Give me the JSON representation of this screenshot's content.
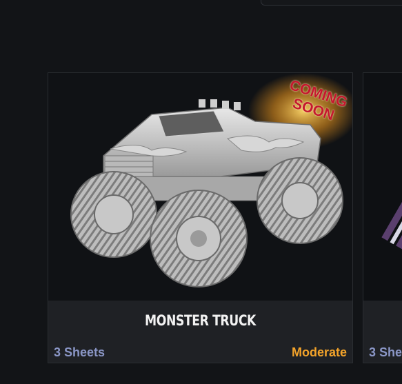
{
  "cards": [
    {
      "title": "MONSTER TRUCK",
      "sheets": "3 Sheets",
      "difficulty": "Moderate",
      "badge": {
        "line1": "COMING",
        "line2": "SOON"
      },
      "image_icon": "monster-truck-model-image"
    },
    {
      "sheets": "3 She",
      "image_icon": "striped-model-image"
    }
  ],
  "colors": {
    "background": "#121417",
    "card_footer": "#1f2125",
    "sheets_text": "#8a96c6",
    "difficulty_text": "#f3a32a",
    "badge_text": "#c5192e"
  }
}
